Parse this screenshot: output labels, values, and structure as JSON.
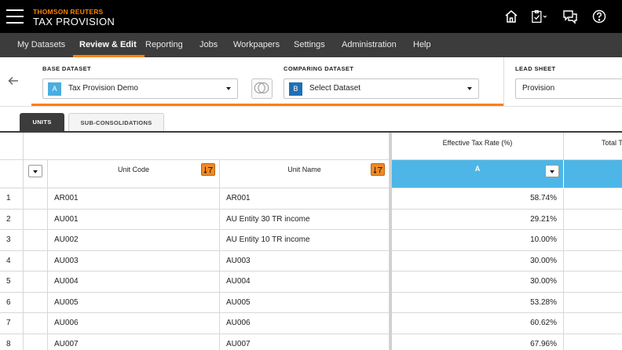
{
  "brand": {
    "company": "THOMSON REUTERS",
    "product": "TAX PROVISION"
  },
  "nav": {
    "items": [
      "My Datasets",
      "Review & Edit",
      "Reporting",
      "Jobs",
      "Workpapers",
      "Settings",
      "Administration",
      "Help"
    ],
    "active_index": 1
  },
  "datasets": {
    "base": {
      "label": "BASE DATASET",
      "badge": "A",
      "value": "Tax Provision Demo"
    },
    "comparing": {
      "label": "COMPARING DATASET",
      "badge": "B",
      "value": "Select Dataset"
    },
    "lead": {
      "label": "LEAD SHEET",
      "value": "Provision"
    }
  },
  "tabs": {
    "units": "UNITS",
    "subcons": "SUB-CONSOLIDATIONS"
  },
  "grid": {
    "group_header": "Effective Tax Rate (%)",
    "group_header_2": "Total T",
    "col_unit_code": "Unit Code",
    "col_unit_name": "Unit Name",
    "col_a": "A",
    "rows": [
      {
        "n": "1",
        "code": "AR001",
        "name": "AR001",
        "etr": "58.74%"
      },
      {
        "n": "2",
        "code": "AU001",
        "name": "AU Entity 30 TR income",
        "etr": "29.21%"
      },
      {
        "n": "3",
        "code": "AU002",
        "name": "AU Entity 10 TR income",
        "etr": "10.00%"
      },
      {
        "n": "4",
        "code": "AU003",
        "name": "AU003",
        "etr": "30.00%"
      },
      {
        "n": "5",
        "code": "AU004",
        "name": "AU004",
        "etr": "30.00%"
      },
      {
        "n": "6",
        "code": "AU005",
        "name": "AU005",
        "etr": "53.28%"
      },
      {
        "n": "7",
        "code": "AU006",
        "name": "AU006",
        "etr": "60.62%"
      },
      {
        "n": "8",
        "code": "AU007",
        "name": "AU007",
        "etr": "67.96%"
      }
    ]
  },
  "colors": {
    "accent": "#ff8000",
    "badge_a": "#4aaee0",
    "badge_b": "#1f6fb5",
    "col_a_header": "#4db6e6",
    "nav_bg": "#3c3c3c"
  }
}
